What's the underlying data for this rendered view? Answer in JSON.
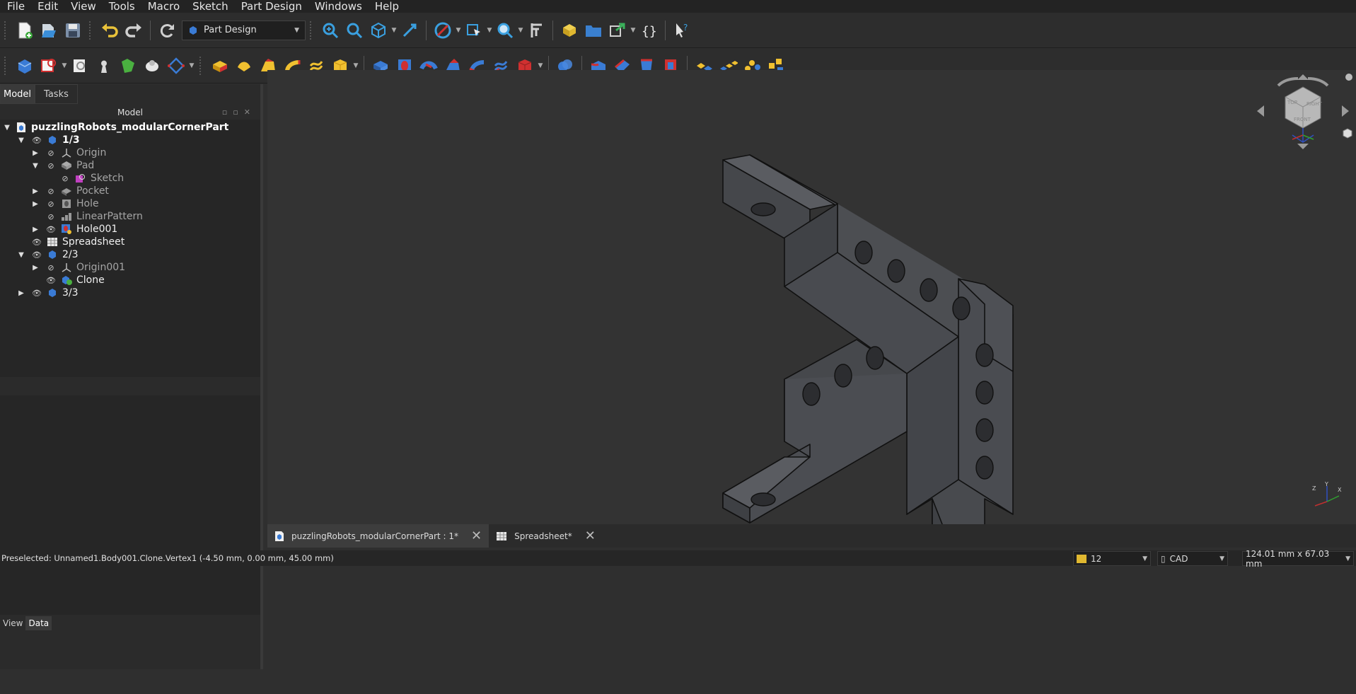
{
  "menu": [
    "File",
    "Edit",
    "View",
    "Tools",
    "Macro",
    "Sketch",
    "Part Design",
    "Windows",
    "Help"
  ],
  "workbench": {
    "selected": "Part Design"
  },
  "panel": {
    "tabs": [
      "Model",
      "Tasks"
    ],
    "tree_title": "Model",
    "bottom_tabs": [
      "View",
      "Data"
    ]
  },
  "tree": {
    "document": "puzzlingRobots_modularCornerPart",
    "body1": "1/3",
    "origin": "Origin",
    "pad": "Pad",
    "sketch": "Sketch",
    "pocket": "Pocket",
    "hole": "Hole",
    "linearpattern": "LinearPattern",
    "hole001": "Hole001",
    "spreadsheet": "Spreadsheet",
    "body2": "2/3",
    "origin001": "Origin001",
    "clone": "Clone",
    "body3": "3/3"
  },
  "doc_tabs": {
    "main": "puzzlingRobots_modularCornerPart : 1*",
    "sheet": "Spreadsheet*"
  },
  "status": {
    "preselected": "Preselected: Unnamed1.Body001.Clone.Vertex1 (-4.50 mm, 0.00 mm, 45.00 mm)",
    "layer": "12",
    "nav_style": "CAD",
    "dimensions": "124.01 mm x 67.03 mm"
  },
  "navcube": {
    "faces": [
      "TOP",
      "RIGHT",
      "FRONT"
    ]
  },
  "triad": {
    "axes": [
      "Z",
      "Y",
      "X"
    ]
  },
  "colors": {
    "background": "#333333",
    "part": "#4a4c50",
    "edges": "#111111",
    "accent": "#3a7bd5"
  }
}
